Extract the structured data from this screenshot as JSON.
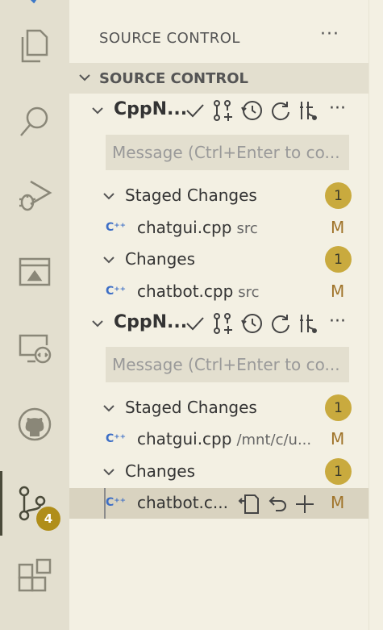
{
  "activity_bar": {
    "items": [
      {
        "name": "explorer-icon"
      },
      {
        "name": "search-icon"
      },
      {
        "name": "run-debug-icon"
      },
      {
        "name": "remote-icon"
      },
      {
        "name": "remote-explorer-icon"
      },
      {
        "name": "github-icon"
      },
      {
        "name": "source-control-icon",
        "badge": "4",
        "active": true
      },
      {
        "name": "extensions-icon"
      }
    ]
  },
  "sidebar": {
    "title": "SOURCE CONTROL",
    "more": "···",
    "section_title": "SOURCE CONTROL",
    "repos": [
      {
        "name": "CppN...",
        "message_placeholder": "Message (Ctrl+Enter to co...",
        "staged": {
          "label": "Staged Changes",
          "count": "1",
          "files": [
            {
              "name": "chatgui.cpp",
              "path": "src",
              "status": "M"
            }
          ]
        },
        "changes": {
          "label": "Changes",
          "count": "1",
          "files": [
            {
              "name": "chatbot.cpp",
              "path": "src",
              "status": "M"
            }
          ]
        }
      },
      {
        "name": "CppN...",
        "message_placeholder": "Message (Ctrl+Enter to co...",
        "staged": {
          "label": "Staged Changes",
          "count": "1",
          "files": [
            {
              "name": "chatgui.cpp",
              "path": "/mnt/c/u...",
              "status": "M"
            }
          ]
        },
        "changes": {
          "label": "Changes",
          "count": "1",
          "files": [
            {
              "name": "chatbot.c...",
              "path": "",
              "status": "M"
            }
          ]
        }
      }
    ],
    "cpp_icon_text": "C⁺⁺"
  }
}
